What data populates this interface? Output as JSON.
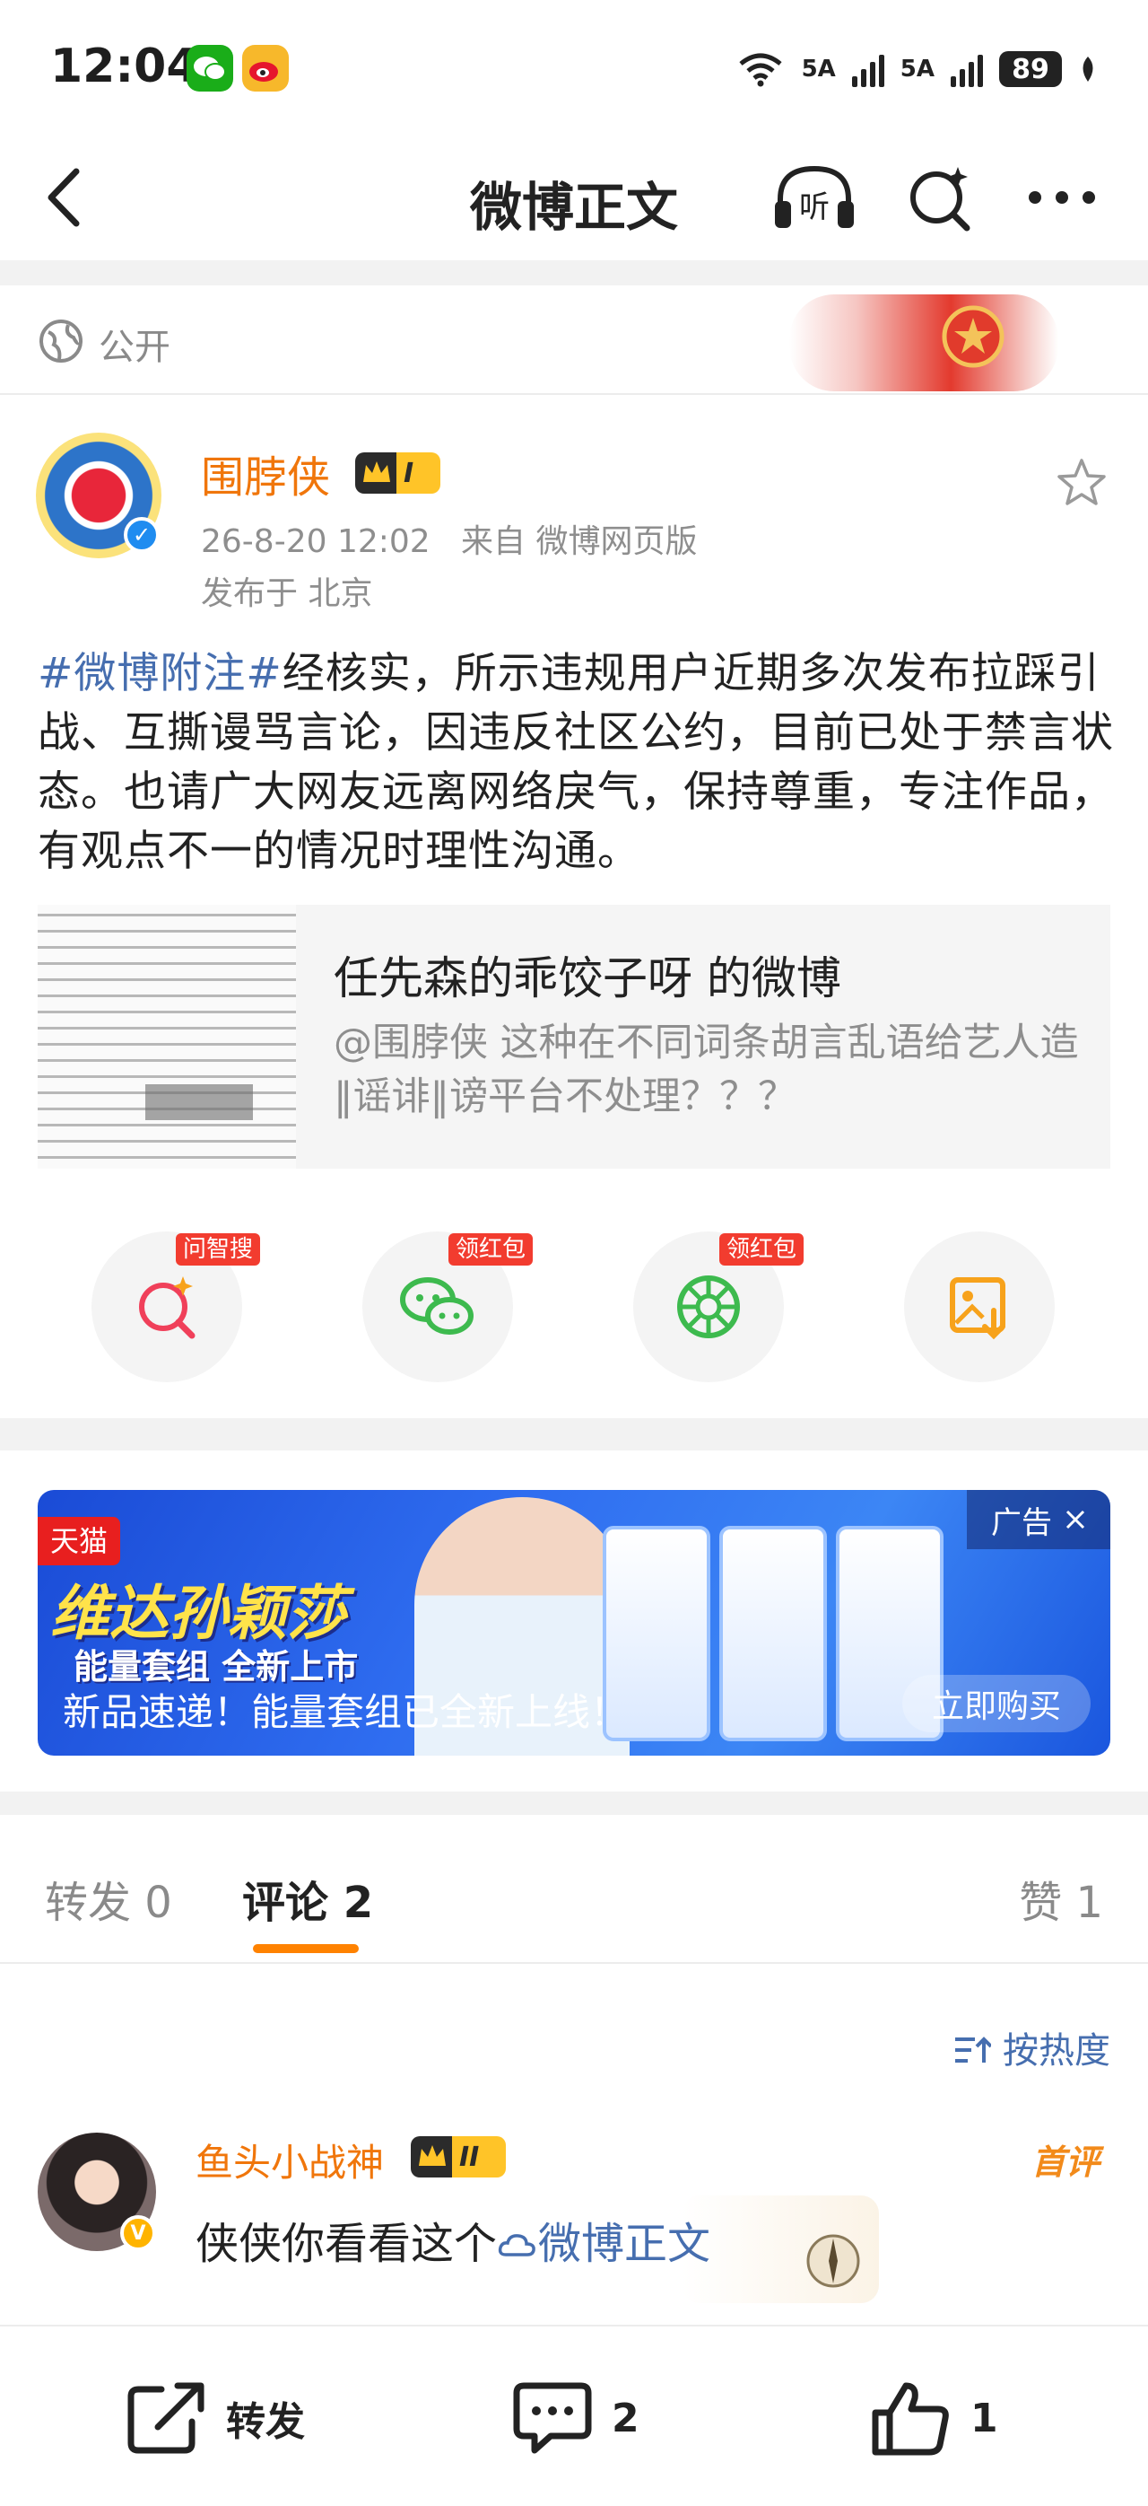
{
  "status_bar": {
    "time": "12:04",
    "network1": "5A",
    "network2": "5A",
    "battery": "89",
    "wifi_label": "6"
  },
  "nav": {
    "title": "微博正文"
  },
  "visibility": {
    "label": "公开"
  },
  "post": {
    "author": "围脖侠",
    "level_badge": "I",
    "time": "26-8-20 12:02",
    "source": "来自 微博网页版",
    "location": "发布于 北京",
    "hashtag": "#微博附注#",
    "text": "经核实，所示违规用户近期多次发布拉踩引战、互撕谩骂言论，因违反社区公约，目前已处于禁言状态。也请广大网友远离网络戾气，保持尊重，专注作品，有观点不一的情况时理性沟通。",
    "quoted": {
      "title": "任先森的乖饺子呀 的微博",
      "text": "@围脖侠 这种在不同词条胡言乱语给艺人造‖谣诽‖谤平台不处理？？？"
    }
  },
  "actions": [
    {
      "icon": "ai-search-icon",
      "tag": "问智搜",
      "color": "#f0405a"
    },
    {
      "icon": "wechat-icon",
      "tag": "领红包",
      "color": "#3dba4e"
    },
    {
      "icon": "moments-icon",
      "tag": "领红包",
      "color": "#3dba4e"
    },
    {
      "icon": "save-image-icon",
      "tag": "",
      "color": "#f7a21b"
    }
  ],
  "ad": {
    "store": "天猫",
    "headline": "维达孙颖莎",
    "subhead": "能量套组 全新上市",
    "caption": "新品速递！能量套组已全新上线！",
    "ad_label": "广告",
    "cta": "立即购买"
  },
  "tabs": {
    "repost": "转发 0",
    "comments": "评论 2",
    "likes": "赞 1"
  },
  "sort_label": "按热度",
  "comments": [
    {
      "user": "鱼头小战神",
      "level_badge": "II",
      "first_label": "首评",
      "text_prefix": "侠侠你看看这个",
      "link_text": "微博正文"
    }
  ],
  "bottom_bar": {
    "repost_label": "转发",
    "comment_count": "2",
    "like_count": "1"
  }
}
